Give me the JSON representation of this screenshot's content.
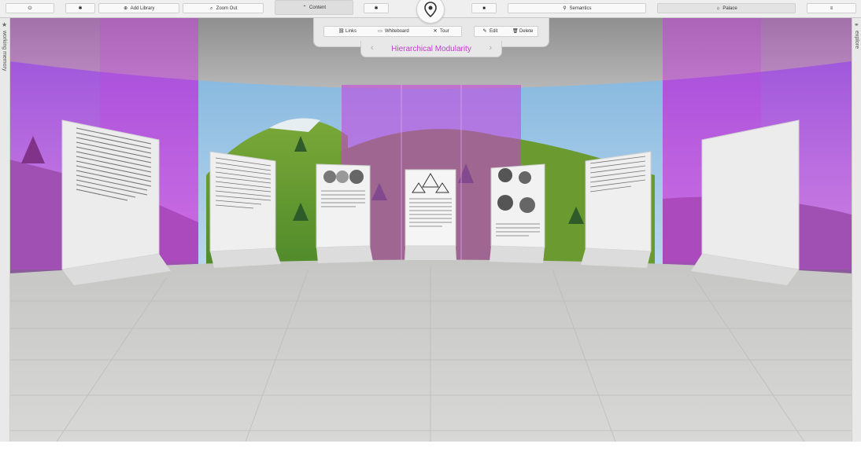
{
  "toolbar": {
    "add_library": "Add Library",
    "zoom_out": "Zoom Out",
    "content": "Content",
    "semantics": "Semantics",
    "palace": "Palace"
  },
  "context_menu": {
    "links": "Links",
    "whiteboard": "Whiteboard",
    "tour": "Tour",
    "edit": "Edit",
    "delete": "Delete",
    "title": "Hierarchical Modularity"
  },
  "side": {
    "left": "working memory",
    "right": "explore"
  },
  "colors": {
    "accent": "#c43bd0",
    "glass": "#c83de0",
    "floor": "#cfcfcd"
  }
}
